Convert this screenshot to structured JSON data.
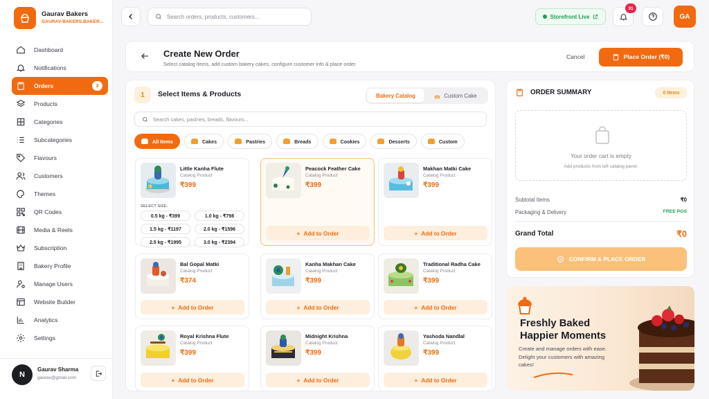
{
  "brand": {
    "name": "Gaurav Bakers",
    "subdomain": "GAURAV-BAKERS.BAKER..."
  },
  "nav": [
    {
      "label": "Dashboard",
      "icon": "home-icon"
    },
    {
      "label": "Notifications",
      "icon": "bell-icon"
    },
    {
      "label": "Orders",
      "icon": "clipboard-icon",
      "badge": "3",
      "active": true
    },
    {
      "label": "Products",
      "icon": "layers-icon"
    },
    {
      "label": "Categories",
      "icon": "grid-icon"
    },
    {
      "label": "Subcategories",
      "icon": "list-icon"
    },
    {
      "label": "Flavours",
      "icon": "tag-icon"
    },
    {
      "label": "Customers",
      "icon": "users-icon"
    },
    {
      "label": "Themes",
      "icon": "palette-icon"
    },
    {
      "label": "QR Codes",
      "icon": "qr-icon"
    },
    {
      "label": "Media & Reels",
      "icon": "film-icon"
    },
    {
      "label": "Subscription",
      "icon": "crown-icon"
    },
    {
      "label": "Bakery Profile",
      "icon": "building-icon"
    },
    {
      "label": "Manage Users",
      "icon": "user-cog-icon"
    },
    {
      "label": "Website Builder",
      "icon": "layout-icon"
    },
    {
      "label": "Analytics",
      "icon": "bar-chart-icon"
    },
    {
      "label": "Settings",
      "icon": "gear-icon"
    }
  ],
  "user": {
    "initial": "N",
    "name": "Gaurav Sharma",
    "email": "gaurav@gmail.com"
  },
  "topbar": {
    "search_placeholder": "Search orders, products, customers...",
    "storefront": "Storefront Live",
    "notif_count": "31",
    "avatar": "GA"
  },
  "header": {
    "title": "Create New Order",
    "subtitle": "Select catalog items, add custom bakery cakes, configure customer info & place order.",
    "cancel": "Cancel",
    "place": "Place Order (₹0)"
  },
  "catalog": {
    "step": "1",
    "title": "Select Items & Products",
    "tabs": [
      "Bakery Catalog",
      "Custom Cake"
    ],
    "search_placeholder": "Search cakes, pastries, breads, flavours...",
    "chips": [
      "All Items",
      "Cakes",
      "Pastries",
      "Breads",
      "Cookies",
      "Desserts",
      "Custom"
    ],
    "size_label": "SELECT SIZE:",
    "sizes": [
      "0.5 kg - ₹399",
      "1.0 kg - ₹798",
      "1.5 kg - ₹1197",
      "2.0 kg - ₹1596",
      "2.5 kg - ₹1995",
      "3.0 kg - ₹2394"
    ],
    "add_label": "Add to Order",
    "products": [
      {
        "name": "Little Kanha Flute",
        "type": "Catalog Product",
        "price": "₹399"
      },
      {
        "name": "Peacock Feather Cake",
        "type": "Catalog Product",
        "price": "₹399"
      },
      {
        "name": "Makhan Matki Cake",
        "type": "Catalog Product",
        "price": "₹399"
      },
      {
        "name": "Bal Gopal Matki",
        "type": "Catalog Product",
        "price": "₹374"
      },
      {
        "name": "Kanha Makhan Cake",
        "type": "Catalog Product",
        "price": "₹399"
      },
      {
        "name": "Traditional Radha Cake",
        "type": "Catalog Product",
        "price": "₹399"
      },
      {
        "name": "Royal Krishna Flute",
        "type": "Catalog Product",
        "price": "₹399"
      },
      {
        "name": "Midnight Krishna",
        "type": "Catalog Product",
        "price": "₹399"
      },
      {
        "name": "Yashoda Nandlal",
        "type": "Catalog Product",
        "price": "₹399"
      }
    ]
  },
  "summary": {
    "title": "ORDER SUMMARY",
    "items": "0 Items",
    "empty_title": "Your order cart is empty",
    "empty_sub": "Add products from left catalog panel.",
    "subtotal_label": "Subtotal Items",
    "subtotal": "₹0",
    "packaging_label": "Packaging & Delivery",
    "packaging": "FREE POS",
    "grand_label": "Grand Total",
    "grand": "₹0",
    "confirm": "CONFIRM & PLACE ORDER"
  },
  "promo": {
    "title1": "Freshly Baked",
    "title2": "Happier Moments",
    "desc": "Create and manage orders with ease. Delight your customers with amazing cakes!"
  },
  "colors": {
    "accent": "#f26a10",
    "success": "#1f9d55",
    "danger": "#e5264b"
  }
}
